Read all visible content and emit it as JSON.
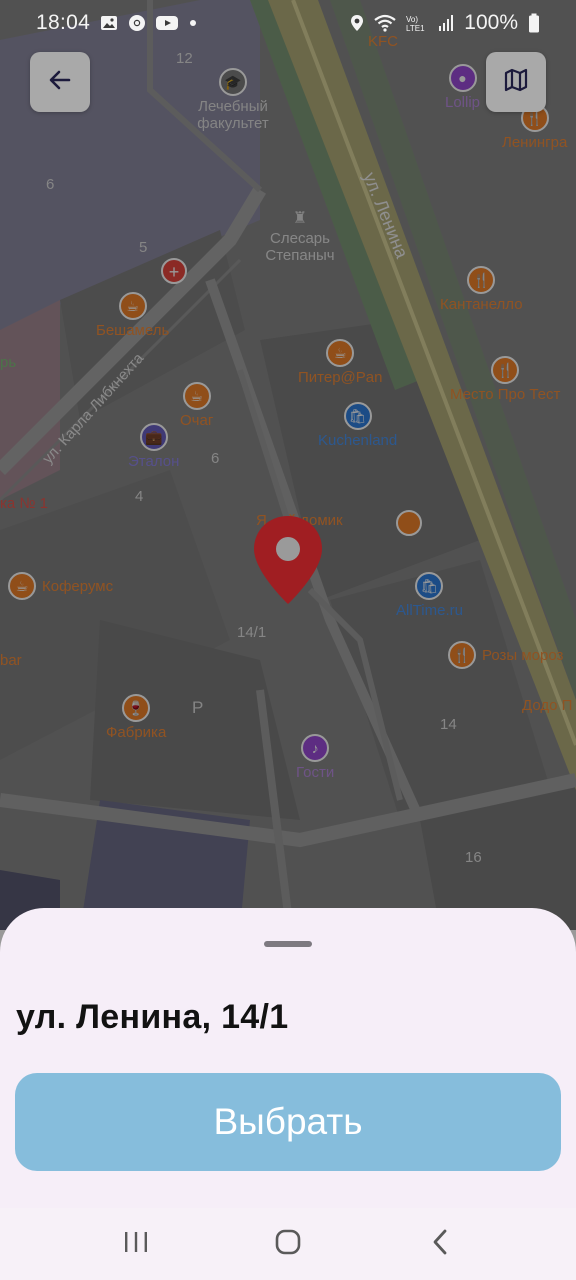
{
  "status_bar": {
    "time": "18:04",
    "battery": "100%",
    "icons": [
      "gallery-icon",
      "chrome-icon",
      "youtube-icon",
      "dot-icon",
      "location-icon",
      "wifi-icon",
      "volte-icon",
      "signal-icon",
      "battery-icon"
    ]
  },
  "map": {
    "streets": [
      "ул. Ленина",
      "ул. Карла Либкнехта"
    ],
    "building_numbers": [
      "12",
      "6",
      "5",
      "6",
      "4",
      "14/1",
      "14",
      "16"
    ],
    "places": [
      {
        "name": "Лечебный факультет",
        "icon": "graduation-cap-icon"
      },
      {
        "name": "Слесарь Степаныч",
        "icon": "monument-icon"
      },
      {
        "name": "KFC",
        "icon": "fast-food-icon"
      },
      {
        "name": "Lollip",
        "icon": "candy-icon"
      },
      {
        "name": "Ленингра",
        "icon": "restaurant-icon"
      },
      {
        "name": "Бешамель",
        "icon": "cafe-icon"
      },
      {
        "name": "Кантанелло",
        "icon": "restaurant-icon"
      },
      {
        "name": "Питер@Pan",
        "icon": "cafe-icon"
      },
      {
        "name": "Место Про Тест",
        "icon": "restaurant-icon"
      },
      {
        "name": "Очаг",
        "icon": "cafe-icon"
      },
      {
        "name": "Kuchenland",
        "icon": "shopping-bag-icon"
      },
      {
        "name": "Эталон",
        "icon": "briefcase-icon"
      },
      {
        "name": "Я...ий домик",
        "icon": "monkey-icon"
      },
      {
        "name": "ка № 1",
        "icon": "pharmacy-icon"
      },
      {
        "name": "Коферумс",
        "icon": "cafe-icon"
      },
      {
        "name": "AllTime.ru",
        "icon": "shopping-bag-icon"
      },
      {
        "name": "Розы мороз",
        "icon": "restaurant-icon"
      },
      {
        "name": "Додо П",
        "icon": "restaurant-icon"
      },
      {
        "name": "Фабрика",
        "icon": "wine-icon"
      },
      {
        "name": "Гости",
        "icon": "music-icon"
      },
      {
        "name": "рь",
        "icon": "none"
      },
      {
        "name": "bar",
        "icon": "none"
      }
    ],
    "pin_icon": "location-pin-icon"
  },
  "back_button": {
    "icon": "arrow-left-icon"
  },
  "map_layers_button": {
    "icon": "map-icon"
  },
  "sheet": {
    "address": "ул. Ленина, 14/1",
    "select_label": "Выбрать"
  },
  "nav_bar": {
    "recents_icon": "recents-icon",
    "home_icon": "home-icon",
    "back_icon": "back-icon"
  },
  "colors": {
    "pin": "#d42b2b",
    "select_button": "#86bddc",
    "sheet_bg": "#f6eef8",
    "road_yellow": "#e9d86a"
  }
}
